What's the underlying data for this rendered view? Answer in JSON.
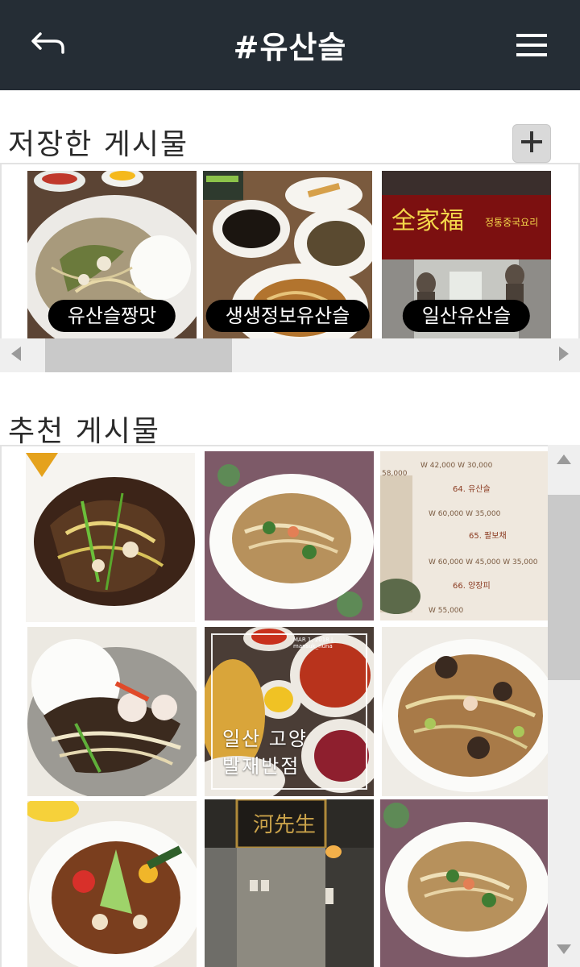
{
  "header": {
    "title": "#유산슬",
    "back_icon": "back-arrow-icon",
    "menu_icon": "hamburger-menu-icon",
    "background": "#252d35"
  },
  "saved": {
    "title": "저장한 게시물",
    "add_icon": "plus-icon",
    "items": [
      {
        "label": "유산슬짱맛"
      },
      {
        "label": "생생정보유산슬"
      },
      {
        "label": "일산유산슬"
      }
    ]
  },
  "recommended": {
    "title": "추천 게시물",
    "overlay": {
      "caption_line1": "일산 고양",
      "caption_line2": "발재반점",
      "meta": "MAR 1, 2018 | mansuk_nuna"
    }
  }
}
